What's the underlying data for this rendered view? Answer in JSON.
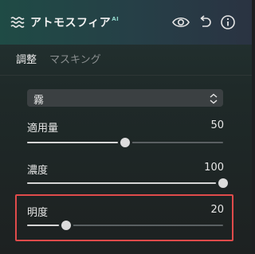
{
  "header": {
    "title": "アトモスフィア",
    "title_badge": "AI",
    "icons": [
      "haze-icon",
      "eye-icon",
      "undo-icon",
      "info-icon"
    ]
  },
  "tabs": [
    {
      "label": "調整",
      "active": true
    },
    {
      "label": "マスキング",
      "active": false
    }
  ],
  "preset_select": {
    "value": "霧"
  },
  "sliders": [
    {
      "label": "適用量",
      "value": "50",
      "level": 0.5
    },
    {
      "label": "濃度",
      "value": "100",
      "level": 1.0
    },
    {
      "label": "明度",
      "value": "20",
      "level": 0.2
    }
  ],
  "colors": {
    "accent": "#e04b4b",
    "header_left": "#1f4b45",
    "header_right": "#2a3342"
  }
}
